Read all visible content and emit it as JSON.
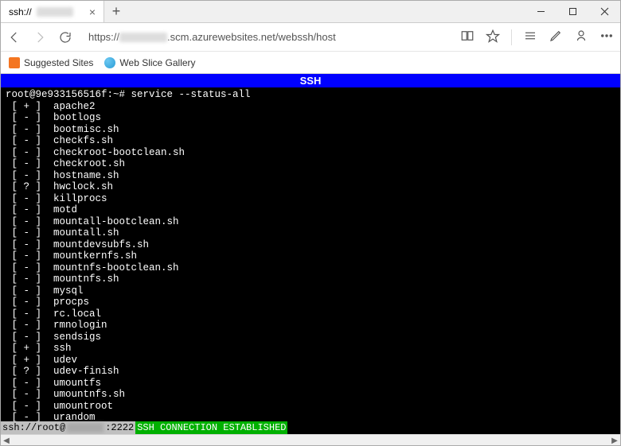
{
  "tab": {
    "prefix": "ssh://"
  },
  "address": {
    "prefix": "https://",
    "suffix": ".scm.azurewebsites.net/webssh/host"
  },
  "favorites": {
    "suggested": "Suggested Sites",
    "webslice": "Web Slice Gallery"
  },
  "ssh_banner": "SSH",
  "prompt": "root@9e933156516f:~#",
  "command": "service --status-all",
  "services": [
    {
      "status": "+",
      "name": "apache2"
    },
    {
      "status": "-",
      "name": "bootlogs"
    },
    {
      "status": "-",
      "name": "bootmisc.sh"
    },
    {
      "status": "-",
      "name": "checkfs.sh"
    },
    {
      "status": "-",
      "name": "checkroot-bootclean.sh"
    },
    {
      "status": "-",
      "name": "checkroot.sh"
    },
    {
      "status": "-",
      "name": "hostname.sh"
    },
    {
      "status": "?",
      "name": "hwclock.sh"
    },
    {
      "status": "-",
      "name": "killprocs"
    },
    {
      "status": "-",
      "name": "motd"
    },
    {
      "status": "-",
      "name": "mountall-bootclean.sh"
    },
    {
      "status": "-",
      "name": "mountall.sh"
    },
    {
      "status": "-",
      "name": "mountdevsubfs.sh"
    },
    {
      "status": "-",
      "name": "mountkernfs.sh"
    },
    {
      "status": "-",
      "name": "mountnfs-bootclean.sh"
    },
    {
      "status": "-",
      "name": "mountnfs.sh"
    },
    {
      "status": "-",
      "name": "mysql"
    },
    {
      "status": "-",
      "name": "procps"
    },
    {
      "status": "-",
      "name": "rc.local"
    },
    {
      "status": "-",
      "name": "rmnologin"
    },
    {
      "status": "-",
      "name": "sendsigs"
    },
    {
      "status": "+",
      "name": "ssh"
    },
    {
      "status": "+",
      "name": "udev"
    },
    {
      "status": "?",
      "name": "udev-finish"
    },
    {
      "status": "-",
      "name": "umountfs"
    },
    {
      "status": "-",
      "name": "umountnfs.sh"
    },
    {
      "status": "-",
      "name": "umountroot"
    },
    {
      "status": "-",
      "name": "urandom"
    }
  ],
  "status": {
    "left_prefix": "ssh://root@",
    "port": ":2222",
    "established": "SSH CONNECTION ESTABLISHED"
  }
}
